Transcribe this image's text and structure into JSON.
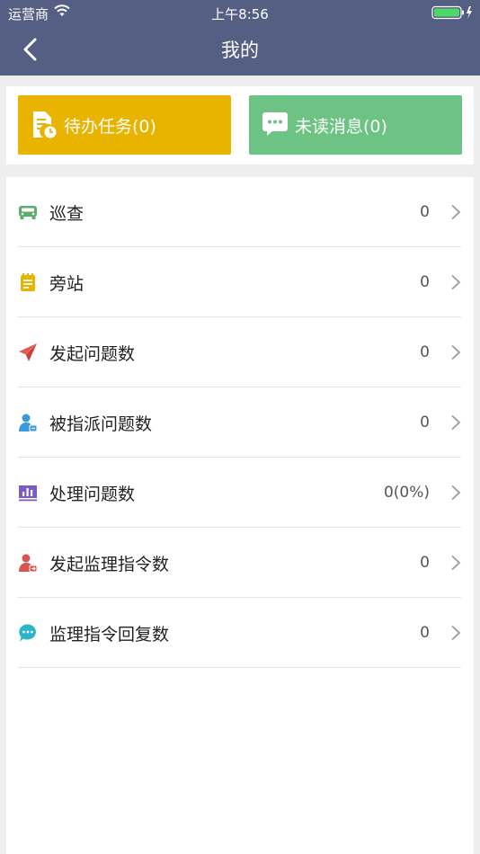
{
  "status_bar": {
    "carrier": "运营商",
    "time": "上午8:56"
  },
  "nav": {
    "title": "我的"
  },
  "cards": [
    {
      "label": "待办任务(0)",
      "icon": "task-doc-icon",
      "color": "#e8b400"
    },
    {
      "label": "未读消息(0)",
      "icon": "message-bubble-icon",
      "color": "#6cc384"
    }
  ],
  "menu": [
    {
      "label": "巡查",
      "value": "0",
      "icon": "car-icon",
      "color": "#5aae6b"
    },
    {
      "label": "旁站",
      "value": "0",
      "icon": "notepad-icon",
      "color": "#e8b400"
    },
    {
      "label": "发起问题数",
      "value": "0",
      "icon": "paper-plane-icon",
      "color": "#e55a4e"
    },
    {
      "label": "被指派问题数",
      "value": "0",
      "icon": "user-assigned-icon",
      "color": "#3b9ad9"
    },
    {
      "label": "处理问题数",
      "value": "0(0%)",
      "icon": "bar-chart-icon",
      "color": "#7b5cc4"
    },
    {
      "label": "发起监理指令数",
      "value": "0",
      "icon": "user-send-icon",
      "color": "#d9534f"
    },
    {
      "label": "监理指令回复数",
      "value": "0",
      "icon": "chat-dots-icon",
      "color": "#2bb5c9"
    }
  ],
  "colors": {
    "header": "#555f84",
    "background": "#eeeeee"
  }
}
